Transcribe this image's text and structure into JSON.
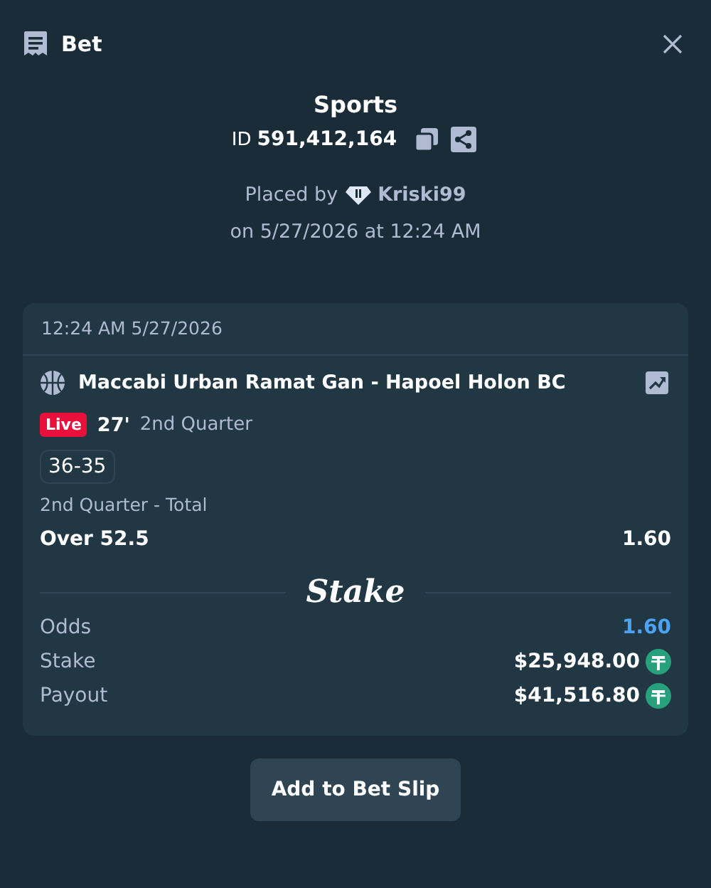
{
  "header": {
    "title": "Bet"
  },
  "summary": {
    "category": "Sports",
    "id_label": "ID",
    "id_value": "591,412,164",
    "placed_by": "Placed by",
    "user": "Kriski99",
    "placed_on": "on 5/27/2026 at 12:24 AM"
  },
  "card": {
    "timestamp": "12:24 AM 5/27/2026",
    "event": "Maccabi Urban Ramat Gan - Hapoel Holon BC",
    "live_badge": "Live",
    "minute": "27'",
    "period": "2nd Quarter",
    "score": "36-35",
    "market": "2nd Quarter - Total",
    "selection": "Over 52.5",
    "selection_odds": "1.60",
    "brand": "Stake",
    "totals": [
      {
        "label": "Odds",
        "value": "1.60",
        "kind": "odds"
      },
      {
        "label": "Stake",
        "value": "$25,948.00",
        "kind": "currency"
      },
      {
        "label": "Payout",
        "value": "$41,516.80",
        "kind": "currency"
      }
    ]
  },
  "button": "Add to Bet Slip"
}
